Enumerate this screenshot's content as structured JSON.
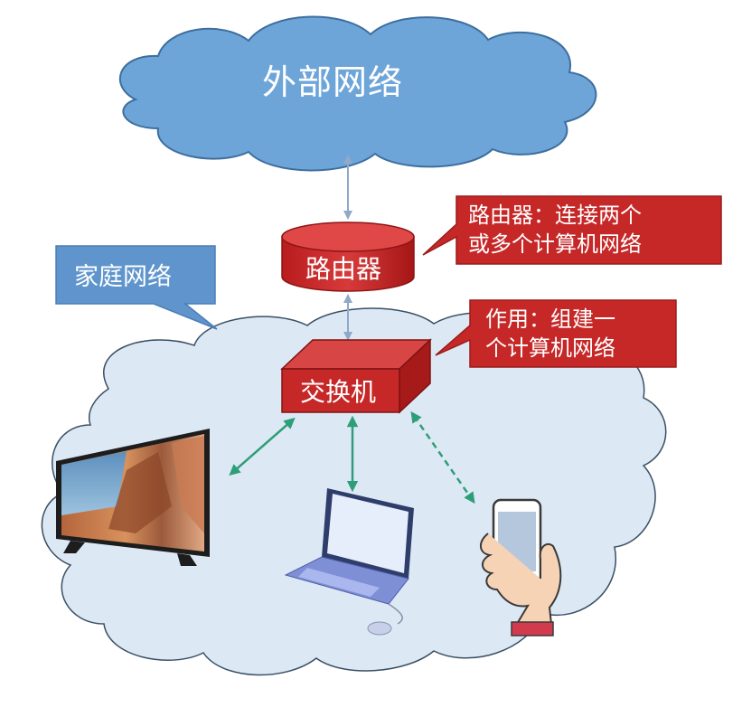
{
  "external_network": {
    "label": "外部网络"
  },
  "home_network": {
    "label": "家庭网络"
  },
  "router": {
    "label": "路由器",
    "description_line1": "路由器：连接两个",
    "description_line2": "或多个计算机网络"
  },
  "switch": {
    "label": "交换机",
    "description_line1": "作用：组建一",
    "description_line2": "个计算机网络"
  },
  "devices": [
    "tv-icon",
    "laptop-icon",
    "smartphone-icon"
  ],
  "colors": {
    "cloud_external": "#6ea5d9",
    "cloud_home": "#dce9f5",
    "callout_blue": "#5f95cc",
    "device_red": "#c62828",
    "link_green": "#2e9e78",
    "link_blue_gray": "#8fa9c8"
  }
}
